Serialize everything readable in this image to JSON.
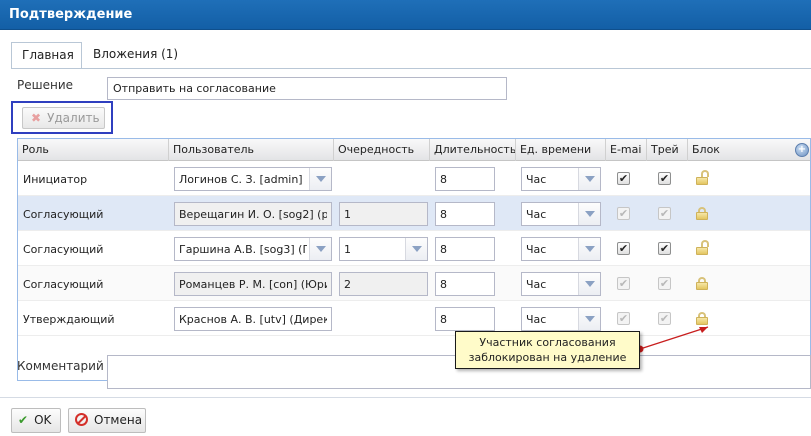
{
  "window": {
    "title": "Подтверждение"
  },
  "tabs": [
    {
      "label": "Главная",
      "active": true
    },
    {
      "label": "Вложения (1)",
      "active": false
    }
  ],
  "decision": {
    "label": "Решение",
    "value": "Отправить на согласование"
  },
  "toolbar": {
    "delete_label": "Удалить"
  },
  "grid": {
    "columns": [
      "Роль",
      "Пользователь",
      "Очередность",
      "Длительность",
      "Ед. времени",
      "E-mai",
      "Трей",
      "Блок"
    ],
    "rows": [
      {
        "role": "Инициатор",
        "user": "Логинов С. З. [admin]",
        "order": "",
        "duration": "8",
        "unit": "Час",
        "email": true,
        "tray": true,
        "locked": false,
        "selected": false
      },
      {
        "role": "Согласующий",
        "user": "Верещагин И. О. [sog2] (ру",
        "order": "1",
        "duration": "8",
        "unit": "Час",
        "email": true,
        "tray": true,
        "locked": true,
        "selected": true
      },
      {
        "role": "Согласующий",
        "user": "Гаршина А.В. [sog3] (Г",
        "order": "1",
        "duration": "8",
        "unit": "Час",
        "email": true,
        "tray": true,
        "locked": false,
        "selected": false
      },
      {
        "role": "Согласующий",
        "user": "Романцев Р. М. [con] (Юрис",
        "order": "2",
        "duration": "8",
        "unit": "Час",
        "email": true,
        "tray": true,
        "locked": true,
        "selected": false
      },
      {
        "role": "Утверждающий",
        "user": "Краснов  А. В. [utv] (Дирек",
        "order": "",
        "duration": "8",
        "unit": "Час",
        "email": true,
        "tray": true,
        "locked": true,
        "selected": false
      }
    ]
  },
  "comment": {
    "label": "Комментарий",
    "value": ""
  },
  "buttons": {
    "ok": "OK",
    "cancel": "Отмена"
  },
  "callout": {
    "line1": "Участник согласования",
    "line2": "заблокирован на удаление"
  },
  "colors": {
    "title_bar": "#1a67b0",
    "selected_row": "#dfe8f6",
    "callout_bg": "#fffbc9",
    "highlight_border": "#2f3fbf"
  }
}
